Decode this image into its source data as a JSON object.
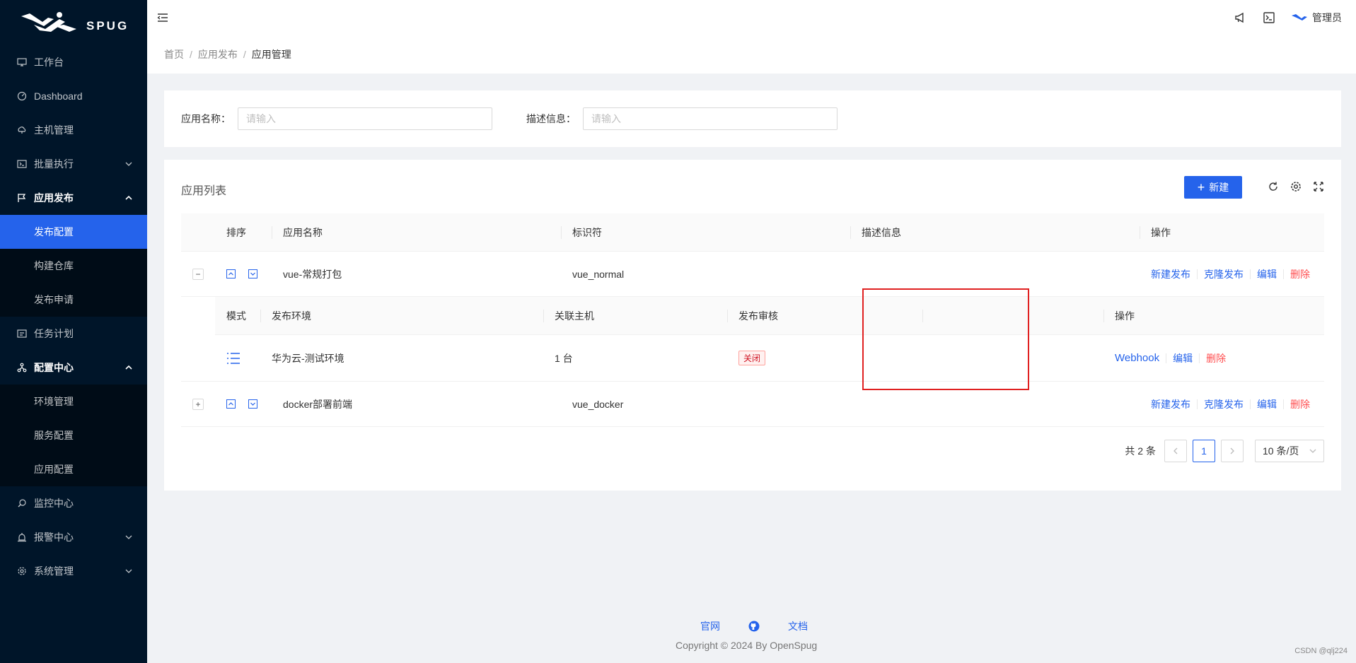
{
  "app": {
    "logo_text": "SPUG"
  },
  "sidebar": {
    "items": [
      {
        "label": "工作台",
        "icon": "desktop-icon"
      },
      {
        "label": "Dashboard",
        "icon": "dashboard-icon"
      },
      {
        "label": "主机管理",
        "icon": "cloud-server-icon"
      },
      {
        "label": "批量执行",
        "icon": "terminal-icon"
      },
      {
        "label": "应用发布",
        "icon": "flag-icon"
      },
      {
        "label": "任务计划",
        "icon": "schedule-icon"
      },
      {
        "label": "配置中心",
        "icon": "deployment-icon"
      },
      {
        "label": "监控中心",
        "icon": "monitor-icon"
      },
      {
        "label": "报警中心",
        "icon": "alert-icon"
      },
      {
        "label": "系统管理",
        "icon": "setting-icon"
      }
    ],
    "deploy_sub": [
      "发布配置",
      "构建仓库",
      "发布申请"
    ],
    "config_sub": [
      "环境管理",
      "服务配置",
      "应用配置"
    ]
  },
  "header": {
    "user": "管理员"
  },
  "breadcrumb": [
    "首页",
    "应用发布",
    "应用管理"
  ],
  "filter": {
    "name_label": "应用名称：",
    "name_placeholder": "请输入",
    "desc_label": "描述信息：",
    "desc_placeholder": "请输入"
  },
  "list": {
    "title": "应用列表",
    "new_button": "新建",
    "columns": [
      "排序",
      "应用名称",
      "标识符",
      "描述信息",
      "操作"
    ],
    "rows": [
      {
        "expand": "−",
        "name": "vue-常规打包",
        "key": "vue_normal",
        "desc": "",
        "actions": [
          "新建发布",
          "克隆发布",
          "编辑",
          "删除"
        ]
      },
      {
        "expand": "+",
        "name": "docker部署前端",
        "key": "vue_docker",
        "desc": "",
        "actions": [
          "新建发布",
          "克隆发布",
          "编辑",
          "删除"
        ]
      }
    ],
    "nested": {
      "columns": [
        "模式",
        "发布环境",
        "关联主机",
        "发布审核",
        "操作"
      ],
      "row": {
        "env": "华为云-测试环境",
        "hosts": "1 台",
        "audit": "关闭",
        "actions": [
          "Webhook",
          "编辑",
          "删除"
        ]
      }
    }
  },
  "pagination": {
    "total": "共 2 条",
    "page": "1",
    "size": "10 条/页"
  },
  "footer": {
    "links": [
      "官网",
      "文档"
    ],
    "copyright": "Copyright © 2024 By OpenSpug"
  },
  "watermark": "CSDN @qlj224",
  "colors": {
    "primary": "#2563eb",
    "danger": "#ff4d4f",
    "sidebar": "#001529",
    "highlight": "#e02020"
  }
}
